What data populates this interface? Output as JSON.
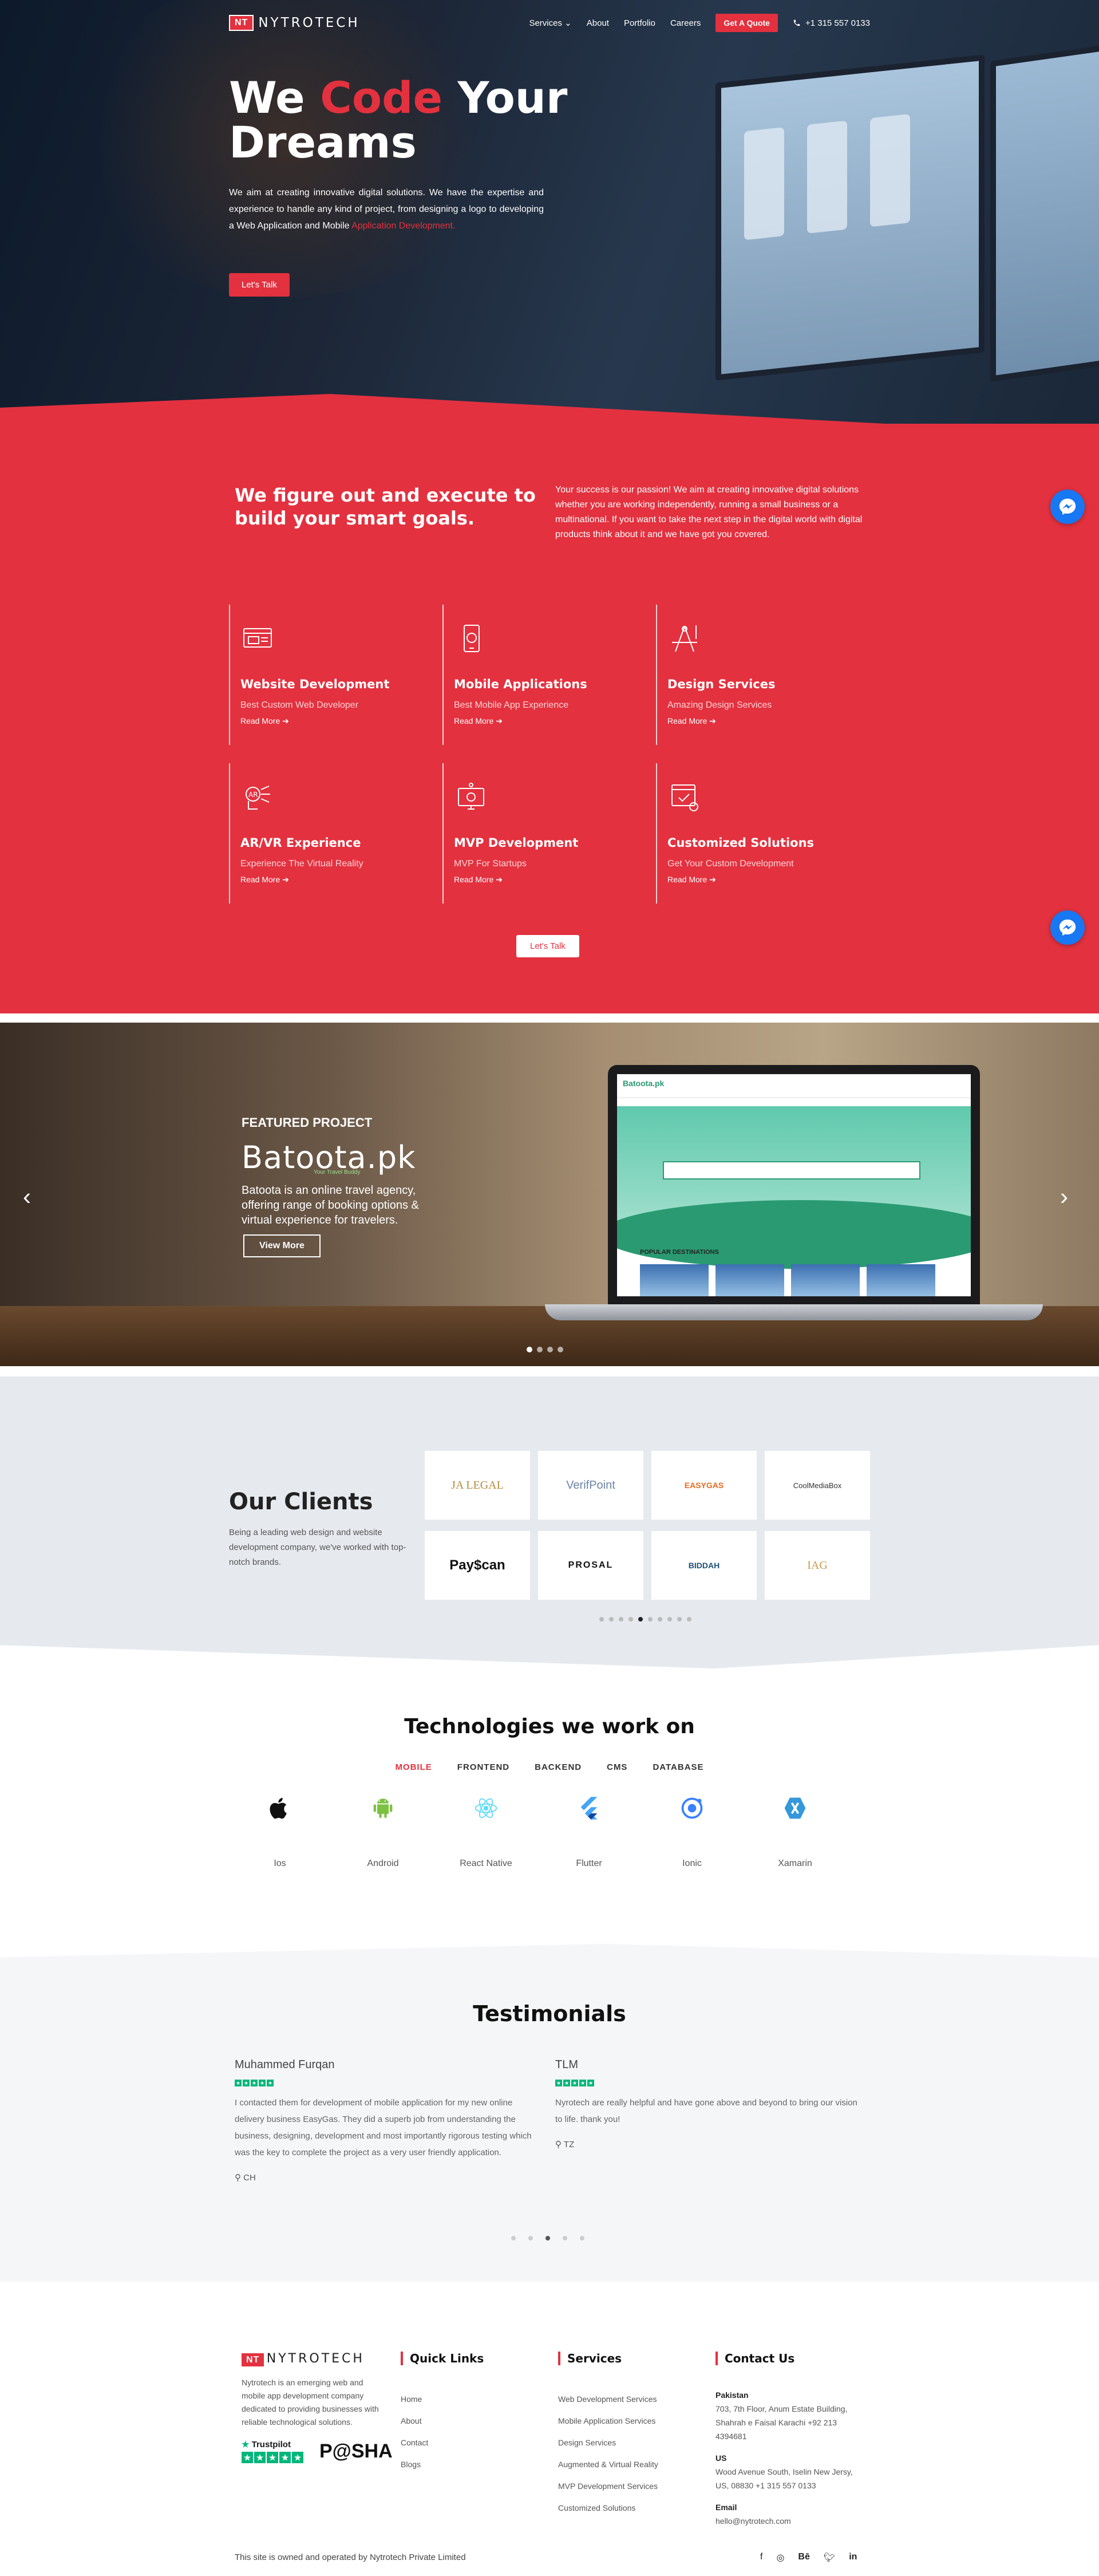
{
  "nav": {
    "logo_mark": "NT",
    "logo_text": "NYTROTECH",
    "items": [
      "Services",
      "About",
      "Portfolio",
      "Careers"
    ],
    "quote_button": "Get A Quote",
    "phone": "+1 315 557 0133"
  },
  "hero": {
    "title_we": "We ",
    "title_code": "Code",
    "title_rest": " Your Dreams",
    "description": "We aim at creating innovative digital solutions. We have the expertise and experience to handle any kind of project, from designing a logo to developing a Web Application and Mobile ",
    "description_highlight": "Application Development.",
    "cta": "Let's Talk"
  },
  "services": {
    "heading": "We figure out and execute to build your smart goals.",
    "intro": "Your success is our passion! We aim at creating innovative digital solutions whether you are working independently, running a small business or a multinational. If you want to take the next step in the digital world with digital products think about it and we have got you covered.",
    "items": [
      {
        "title": "Website Development",
        "sub": "Best Custom Web Developer",
        "more": "Read More"
      },
      {
        "title": "Mobile Applications",
        "sub": "Best Mobile App Experience",
        "more": "Read More"
      },
      {
        "title": "Design Services",
        "sub": "Amazing Design Services",
        "more": "Read More"
      },
      {
        "title": "AR/VR Experience",
        "sub": "Experience The Virtual Reality",
        "more": "Read More"
      },
      {
        "title": "MVP Development",
        "sub": "MVP For Startups",
        "more": "Read More"
      },
      {
        "title": "Customized Solutions",
        "sub": "Get Your Custom Development",
        "more": "Read More"
      }
    ],
    "cta": "Let's Talk"
  },
  "featured": {
    "label": "FEATURED PROJECT",
    "brand": "Batoota.pk",
    "tagline": "Your Travel Buddy",
    "description": "Batoota is an online travel agency, offering range of booking options & virtual experience for travelers.",
    "button": "View More",
    "screen_section": "POPULAR DESTINATIONS"
  },
  "clients": {
    "heading": "Our Clients",
    "description": "Being a leading web design and website development company, we've worked with top-notch brands.",
    "logos": [
      "JA LEGAL",
      "VerifPoint",
      "EASYGAS",
      "CoolMediaBox",
      "Pay$can",
      "PROSAL",
      "BIDDAH",
      "IAG"
    ]
  },
  "tech": {
    "heading": "Technologies we work on",
    "tabs": [
      "MOBILE",
      "FRONTEND",
      "BACKEND",
      "CMS",
      "DATABASE"
    ],
    "items": [
      "Ios",
      "Android",
      "React Native",
      "Flutter",
      "Ionic",
      "Xamarin"
    ]
  },
  "testimonials": {
    "heading": "Testimonials",
    "items": [
      {
        "name": "Muhammed Furqan",
        "text": "I contacted them for development of mobile application for my new online delivery business EasyGas. They did a superb job from understanding the business, designing, development and most importantly rigorous testing which was the key to complete the project as a very user friendly application.",
        "location": "CH"
      },
      {
        "name": "TLM",
        "text": "Nyrotech are really helpful and have gone above and beyond to bring our vision to life. thank you!",
        "location": "TZ"
      }
    ]
  },
  "footer": {
    "about": "Nytrotech is an emerging web and mobile app development company dedicated to providing businesses with reliable technological solutions.",
    "trustpilot": "Trustpilot",
    "pasha": "P@SHA",
    "quick_links_heading": "Quick Links",
    "quick_links": [
      "Home",
      "About",
      "Contact",
      "Blogs"
    ],
    "services_heading": "Services",
    "services": [
      "Web Development Services",
      "Mobile Application Services",
      "Design Services",
      "Augmented & Virtual Reality",
      "MVP Development Services",
      "Customized Solutions"
    ],
    "contact_heading": "Contact Us",
    "pakistan_label": "Pakistan",
    "pakistan_address": "703, 7th Floor, Anum Estate Building, Shahrah e Faisal Karachi +92 213 4394681",
    "us_label": "US",
    "us_address": "Wood Avenue South, Iselin New Jersy, US, 08830 +1 315 557 0133",
    "email_label": "Email",
    "email": "hello@nytrotech.com",
    "copyright": "This site is owned and operated by Nytrotech Private Limited"
  },
  "colors": {
    "brand_red": "#e3313f",
    "messenger_blue": "#1877f2",
    "trustpilot_green": "#00b67a"
  }
}
